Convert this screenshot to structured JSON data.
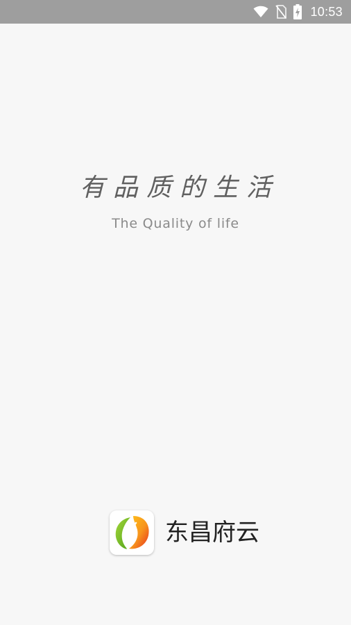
{
  "status_bar": {
    "time": "10:53",
    "icons": [
      "wifi-icon",
      "no-sim-icon",
      "battery-charging-icon"
    ]
  },
  "splash": {
    "slogan_cn": "有品质的生活",
    "slogan_en": "The Quality of life"
  },
  "brand": {
    "app_name": "东昌府云",
    "logo_icon": "leaf-logo-icon"
  },
  "colors": {
    "status_bar_bg": "#9e9e9e",
    "page_bg": "#f7f7f7",
    "logo_green": "#7cc22a",
    "logo_orange": "#f7941d",
    "logo_red": "#e8321e"
  }
}
